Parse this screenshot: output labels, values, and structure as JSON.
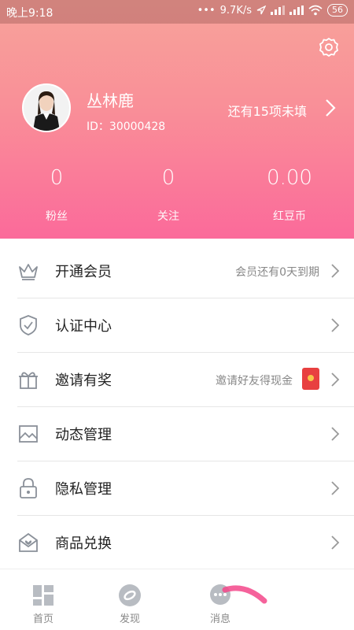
{
  "status_bar": {
    "time": "晚上9:18",
    "speed": "9.7K/s",
    "battery": "56"
  },
  "profile": {
    "name": "丛林鹿",
    "id": "ID：30000428",
    "hint": "还有15项未填"
  },
  "stats": [
    {
      "value": "0",
      "label": "粉丝"
    },
    {
      "value": "0",
      "label": "关注"
    },
    {
      "value": "0.00",
      "label": "红豆币"
    }
  ],
  "menu": {
    "items": [
      {
        "label": "开通会员",
        "sub": "会员还有0天到期",
        "icon": "crown-icon"
      },
      {
        "label": "认证中心",
        "sub": "",
        "icon": "shield-check-icon"
      },
      {
        "label": "邀请有奖",
        "sub": "邀请好友得现金",
        "icon": "gift-icon"
      },
      {
        "label": "动态管理",
        "sub": "",
        "icon": "image-icon"
      },
      {
        "label": "隐私管理",
        "sub": "",
        "icon": "lock-icon"
      },
      {
        "label": "商品兑换",
        "sub": "",
        "icon": "mail-heart-icon"
      }
    ]
  },
  "tabbar": {
    "tabs": [
      {
        "label": "首页",
        "icon": "home-grid-icon"
      },
      {
        "label": "发现",
        "icon": "discover-icon"
      },
      {
        "label": "消息",
        "icon": "message-icon"
      }
    ]
  },
  "colors": {
    "gradient_top": "#f8a39a",
    "gradient_bottom": "#fb6a9a",
    "icon_gray": "#8a9099"
  }
}
